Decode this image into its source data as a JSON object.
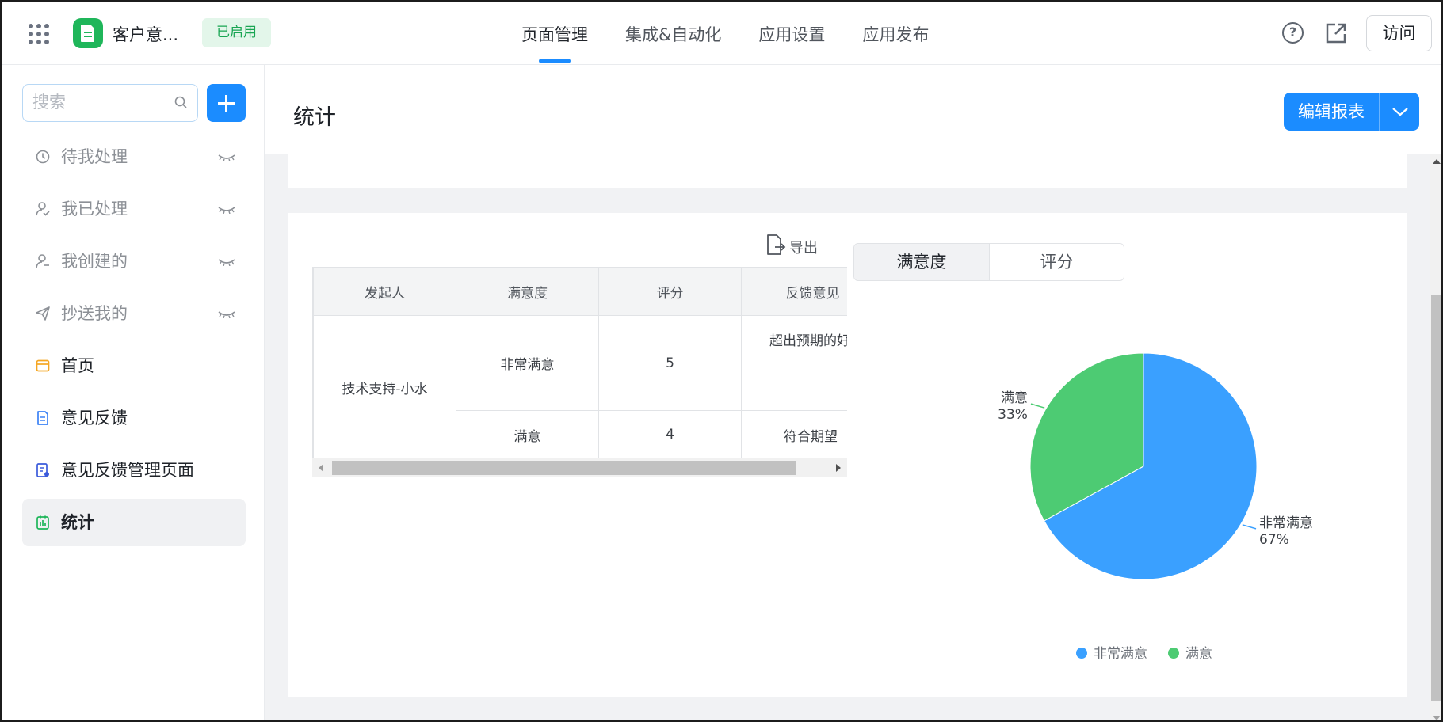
{
  "app": {
    "name": "客户意...",
    "status": "已启用"
  },
  "nav": {
    "tabs": [
      "页面管理",
      "集成&自动化",
      "应用设置",
      "应用发布"
    ],
    "active_index": 0
  },
  "header_actions": {
    "visit_label": "访问"
  },
  "sidebar": {
    "search_placeholder": "搜索",
    "items": [
      {
        "label": "待我处理",
        "icon": "clock-icon",
        "muted": true,
        "hidden_eye": true
      },
      {
        "label": "我已处理",
        "icon": "user-check-icon",
        "muted": true,
        "hidden_eye": true
      },
      {
        "label": "我创建的",
        "icon": "user-add-icon",
        "muted": true,
        "hidden_eye": true
      },
      {
        "label": "抄送我的",
        "icon": "send-icon",
        "muted": true,
        "hidden_eye": true
      },
      {
        "label": "首页",
        "icon": "home-page-icon"
      },
      {
        "label": "意见反馈",
        "icon": "form-icon"
      },
      {
        "label": "意见反馈管理页面",
        "icon": "manage-page-icon"
      },
      {
        "label": "统计",
        "icon": "report-icon",
        "active": true
      }
    ]
  },
  "page": {
    "title": "统计",
    "edit_report_label": "编辑报表"
  },
  "table": {
    "export_label": "导出",
    "columns": [
      "发起人",
      "满意度",
      "评分",
      "反馈意见"
    ],
    "rows": [
      {
        "initiator": "技术支持-小水",
        "satisfaction": "非常满意",
        "score": "5",
        "feedback": [
          "超出预期的好",
          ""
        ]
      },
      {
        "satisfaction": "满意",
        "score": "4",
        "feedback": [
          "符合期望"
        ]
      }
    ]
  },
  "chart_tabs": {
    "items": [
      "满意度",
      "评分"
    ],
    "active_index": 0
  },
  "chart_data": {
    "type": "pie",
    "categories": [
      "非常满意",
      "满意"
    ],
    "values": [
      67,
      33
    ],
    "labels": [
      "67%",
      "33%"
    ],
    "colors": [
      "#3aa0ff",
      "#4dcb73"
    ],
    "legend": "bottom-center"
  }
}
